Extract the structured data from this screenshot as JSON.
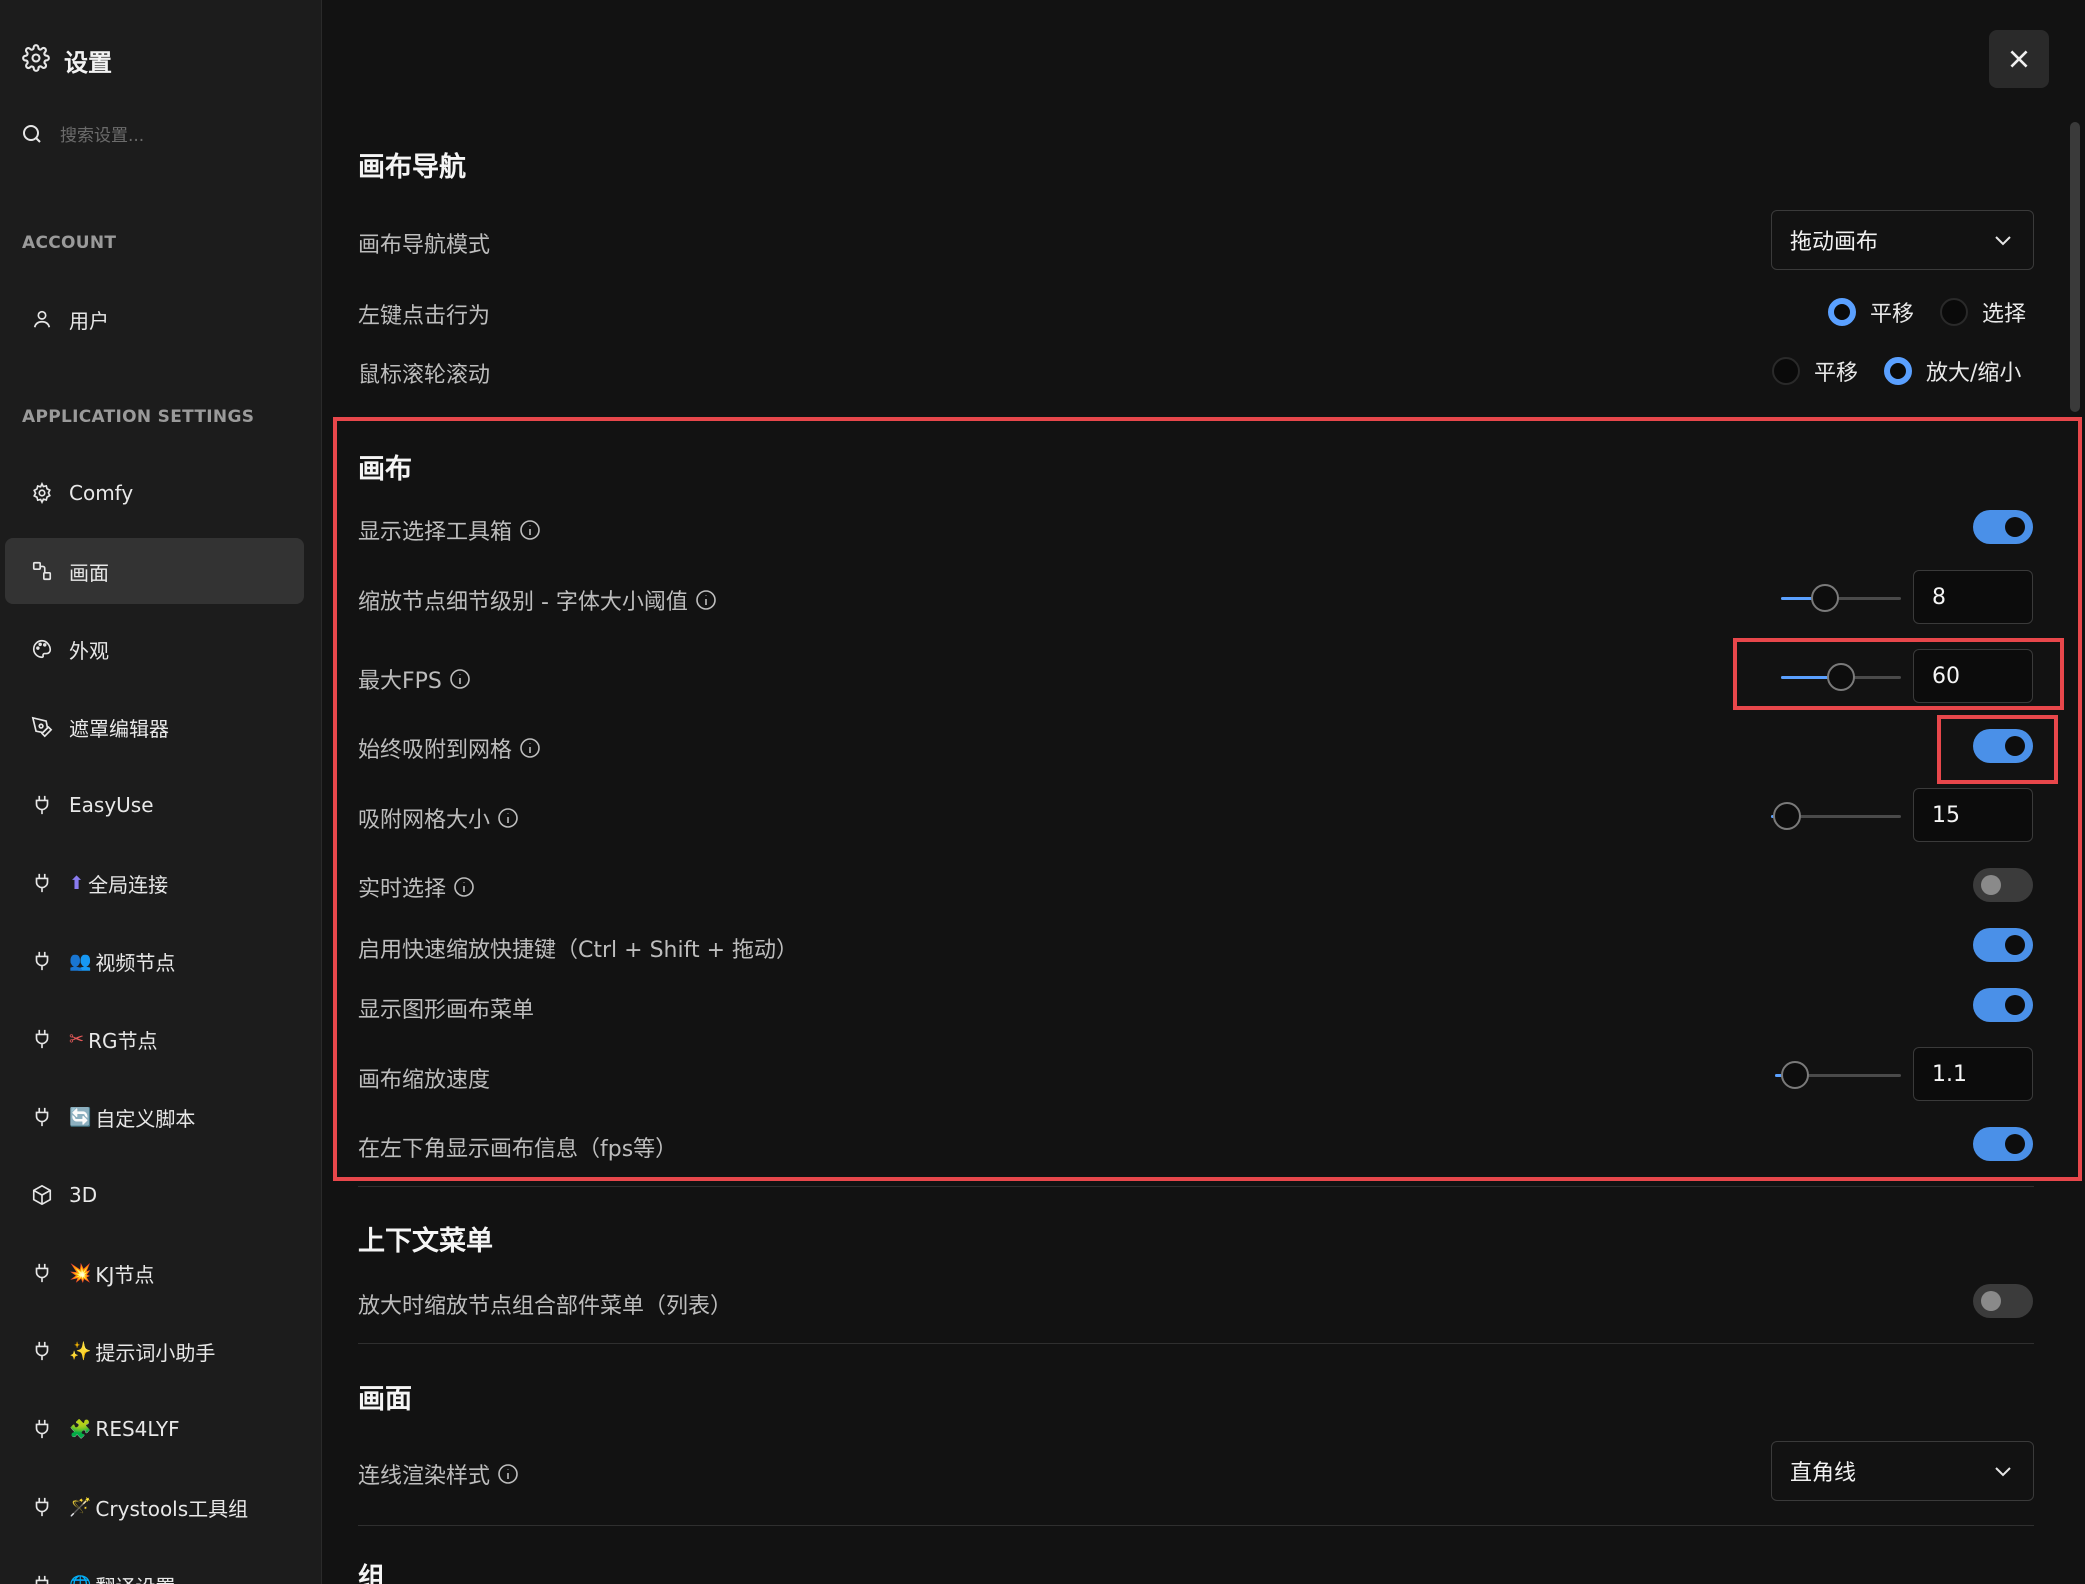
{
  "sidebar": {
    "title": "设置",
    "search_placeholder": "搜索设置...",
    "section_account": "ACCOUNT",
    "section_app": "APPLICATION SETTINGS",
    "items": [
      {
        "label": "用户",
        "emoji": ""
      },
      {
        "label": "Comfy",
        "emoji": ""
      },
      {
        "label": "画面",
        "emoji": ""
      },
      {
        "label": "外观",
        "emoji": ""
      },
      {
        "label": "遮罩编辑器",
        "emoji": ""
      },
      {
        "label": "EasyUse",
        "emoji": ""
      },
      {
        "label": "全局连接",
        "emoji": "⬆"
      },
      {
        "label": "视频节点",
        "emoji": "👥"
      },
      {
        "label": "RG节点",
        "emoji": "✂"
      },
      {
        "label": "自定义脚本",
        "emoji": "🔄"
      },
      {
        "label": "3D",
        "emoji": ""
      },
      {
        "label": "KJ节点",
        "emoji": "💥"
      },
      {
        "label": "提示词小助手",
        "emoji": "✨"
      },
      {
        "label": "RES4LYF",
        "emoji": "🧩"
      },
      {
        "label": "Crystools工具组",
        "emoji": "🪄"
      },
      {
        "label": "翻译设置",
        "emoji": "🌐"
      }
    ]
  },
  "nav": {
    "title": "画布导航",
    "mode_label": "画布导航模式",
    "mode_value": "拖动画布",
    "left_click_label": "左键点击行为",
    "left_click_options": [
      "平移",
      "选择"
    ],
    "wheel_label": "鼠标滚轮滚动",
    "wheel_options": [
      "平移",
      "放大/缩小"
    ]
  },
  "canvas": {
    "title": "画布",
    "show_toolbox": "显示选择工具箱",
    "lod_threshold": "缩放节点细节级别 - 字体大小阈值",
    "lod_value": "8",
    "lod_fraction": 0.33,
    "max_fps": "最大FPS",
    "max_fps_value": "60",
    "max_fps_fraction": 0.5,
    "snap_grid": "始终吸附到网格",
    "snap_size": "吸附网格大小",
    "snap_size_value": "15",
    "snap_size_fraction": 0.02,
    "live_select": "实时选择",
    "fast_zoom": "启用快速缩放快捷键（Ctrl + Shift + 拖动）",
    "graph_menu": "显示图形画布菜单",
    "zoom_speed": "画布缩放速度",
    "zoom_speed_value": "1.1",
    "zoom_speed_fraction": 0.06,
    "show_info": "在左下角显示画布信息（fps等）"
  },
  "context": {
    "title": "上下文菜单",
    "widget_menu": "放大时缩放节点组合部件菜单（列表）"
  },
  "screen": {
    "title": "画面",
    "link_style": "连线渲染样式",
    "link_style_value": "直角线"
  },
  "group": {
    "title": "组"
  },
  "colors": {
    "accent": "#4a90e8",
    "highlight": "#e8474b"
  }
}
